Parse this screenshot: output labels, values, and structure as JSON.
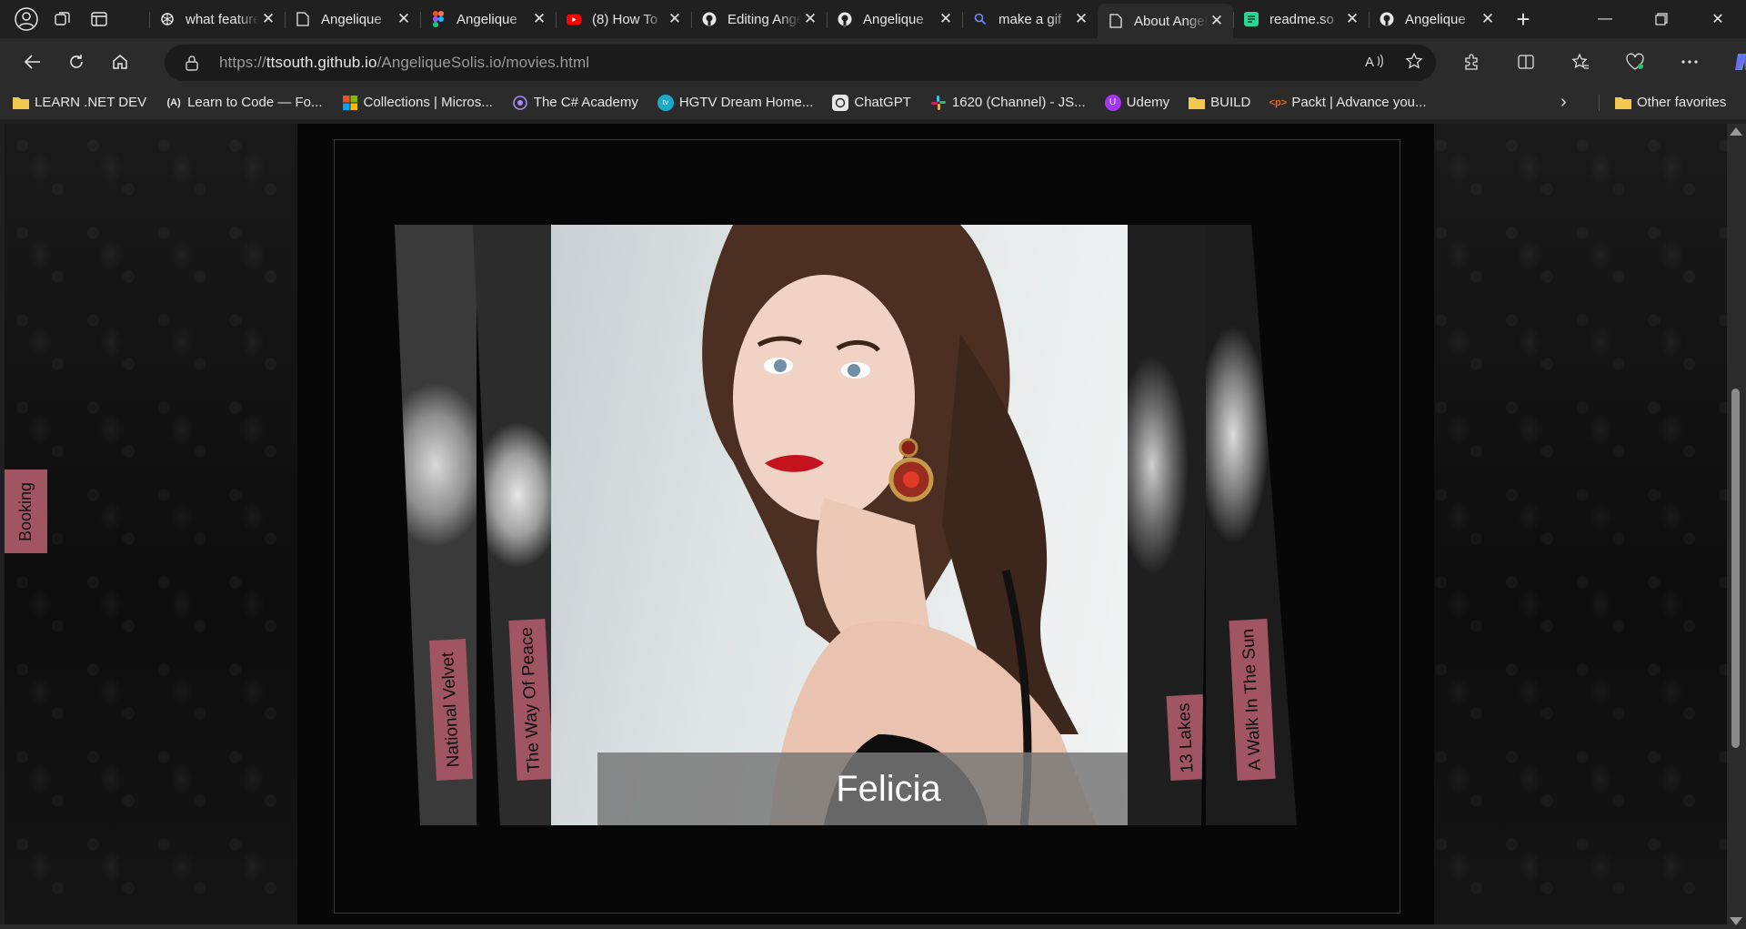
{
  "browser": {
    "tabs": [
      {
        "label": "what features",
        "favicon": "openai-icon",
        "color": "#e8e8e8"
      },
      {
        "label": "Angelique",
        "favicon": "page-icon",
        "color": "#e8e8e8"
      },
      {
        "label": "Angelique",
        "favicon": "figma-icon",
        "color": "#f24e1e"
      },
      {
        "label": "(8) How To",
        "favicon": "youtube-icon",
        "color": "#ff0000"
      },
      {
        "label": "Editing Angelique",
        "favicon": "github-icon",
        "color": "#e8e8e8"
      },
      {
        "label": "Angelique",
        "favicon": "github-icon",
        "color": "#e8e8e8"
      },
      {
        "label": "make a gif",
        "favicon": "search-icon",
        "color": "#6b8cff"
      },
      {
        "label": "About Angelique",
        "favicon": "page-icon",
        "color": "#e8e8e8",
        "active": true
      },
      {
        "label": "readme.so",
        "favicon": "readme-icon",
        "color": "#27d796"
      },
      {
        "label": "Angelique",
        "favicon": "github-icon",
        "color": "#e8e8e8"
      }
    ],
    "address": {
      "scheme": "https://",
      "host": "ttsouth.github.io",
      "path": "/AngeliqueSolis.io/movies.html"
    },
    "bookmarks": [
      {
        "label": "LEARN .NET DEV",
        "icon": "folder-icon",
        "color": "#f2c94c"
      },
      {
        "label": "Learn to Code — Fo...",
        "icon": "freecodecamp-icon",
        "color": "#e8e8e8"
      },
      {
        "label": "Collections | Micros...",
        "icon": "microsoft-icon",
        "color": "#f25022"
      },
      {
        "label": "The C# Academy",
        "icon": "csharp-academy-icon",
        "color": "#a78bfa"
      },
      {
        "label": "HGTV Dream Home...",
        "icon": "hgtv-icon",
        "color": "#1ba9c9"
      },
      {
        "label": "ChatGPT",
        "icon": "chatgpt-icon",
        "color": "#e8e8e8"
      },
      {
        "label": "1620 (Channel) - JS...",
        "icon": "slack-icon",
        "color": "#e01e5a"
      },
      {
        "label": "Udemy",
        "icon": "udemy-icon",
        "color": "#a435f0"
      },
      {
        "label": "BUILD",
        "icon": "folder-icon",
        "color": "#f2c94c"
      },
      {
        "label": "Packt | Advance you...",
        "icon": "packt-icon",
        "color": "#ec6611"
      }
    ],
    "other_favorites": "Other favorites"
  },
  "page": {
    "side_tab": "Booking",
    "featured_name": "Felicia",
    "left_strips": [
      "National Velvet",
      "The Way Of Peace"
    ],
    "right_strips": [
      "13 Lakes",
      "A Walk In The Sun"
    ],
    "accent_color": "#a15562"
  }
}
